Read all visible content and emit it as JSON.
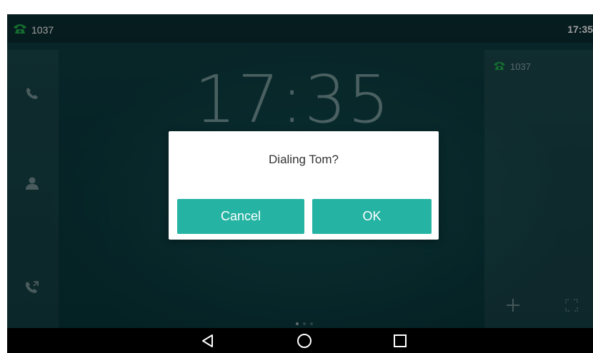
{
  "status_bar": {
    "account": "1037",
    "time": "17:35"
  },
  "home": {
    "clock": "17:35",
    "right_panel_account": "1037"
  },
  "dialog": {
    "message": "Dialing Tom?",
    "cancel_label": "Cancel",
    "ok_label": "OK"
  },
  "icons": {
    "account": "phone-handset-icon",
    "rail": [
      "phone-icon",
      "contact-icon",
      "call-history-icon"
    ],
    "right_panel": [
      "plus-icon",
      "expand-icon"
    ],
    "nav": [
      "back-icon",
      "home-icon",
      "recents-icon"
    ]
  },
  "colors": {
    "accent": "#25b3a3",
    "account_icon": "#22b14c",
    "background": "#0b3b40"
  }
}
